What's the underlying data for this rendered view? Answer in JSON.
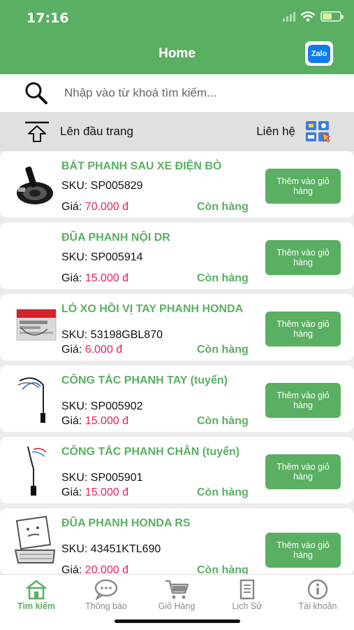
{
  "status_bar": {
    "time": "17:16"
  },
  "header": {
    "title": "Home",
    "zalo_label": "Zalo"
  },
  "search": {
    "placeholder": "Nhập vào từ khoá tìm kiếm..."
  },
  "topbar": {
    "top_label": "Lên đầu trang",
    "contact_label": "Liên hệ"
  },
  "products": [
    {
      "name": "BÁT PHANH SAU XE ĐIỆN BÒ",
      "sku": "SKU: SP005829",
      "price_label": "Giá:",
      "price": "70.000 đ",
      "stock": "Còn hàng",
      "button": "Thêm vào giỏ hàng",
      "icon": "brake-shoe-image"
    },
    {
      "name": "ĐŨA PHANH NỘI DR",
      "sku": "SKU: SP005914",
      "price_label": "Giá:",
      "price": "15.000 đ",
      "stock": "Còn hàng",
      "button": "Thêm vào giỏ hàng",
      "icon": "no-image"
    },
    {
      "name": "LÒ XO HỒI VỊ TAY PHANH HONDA",
      "sku": "SKU: 53198GBL870",
      "price_label": "Giá:",
      "price": "6.000 đ",
      "stock": "Còn hàng",
      "button": "Thêm vào giỏ hàng",
      "icon": "honda-package-image"
    },
    {
      "name": "CÔNG TẮC PHANH TAY (tuyển)",
      "sku": "SKU: SP005902",
      "price_label": "Giá:",
      "price": "15.000 đ",
      "stock": "Còn hàng",
      "button": "Thêm vào giỏ hàng",
      "icon": "switch-cable-image"
    },
    {
      "name": "CÔNG TẮC PHANH CHÂN (tuyển)",
      "sku": "SKU: SP005901",
      "price_label": "Giá:",
      "price": "15.000 đ",
      "stock": "Còn hàng",
      "button": "Thêm vào giỏ hàng",
      "icon": "switch-cable-image"
    },
    {
      "name": "ĐŨA PHANH HONDA RS",
      "sku": "SKU: 43451KTL690",
      "price_label": "Giá:",
      "price": "20.000 đ",
      "stock": "Còn hàng",
      "button": "Thêm vào giỏ hàng",
      "icon": "placeholder-cart-image"
    }
  ],
  "tabs": [
    {
      "label": "Tìm kiếm",
      "icon": "home-icon",
      "active": true
    },
    {
      "label": "Thông báo",
      "icon": "chat-icon",
      "active": false
    },
    {
      "label": "Giỏ Hàng",
      "icon": "cart-icon",
      "active": false
    },
    {
      "label": "Lịch Sử",
      "icon": "document-icon",
      "active": false
    },
    {
      "label": "Tài khoản",
      "icon": "info-icon",
      "active": false
    }
  ],
  "colors": {
    "primary": "#5aaf62",
    "price": "#e0245e",
    "tab_inactive": "#8a8a8a"
  }
}
